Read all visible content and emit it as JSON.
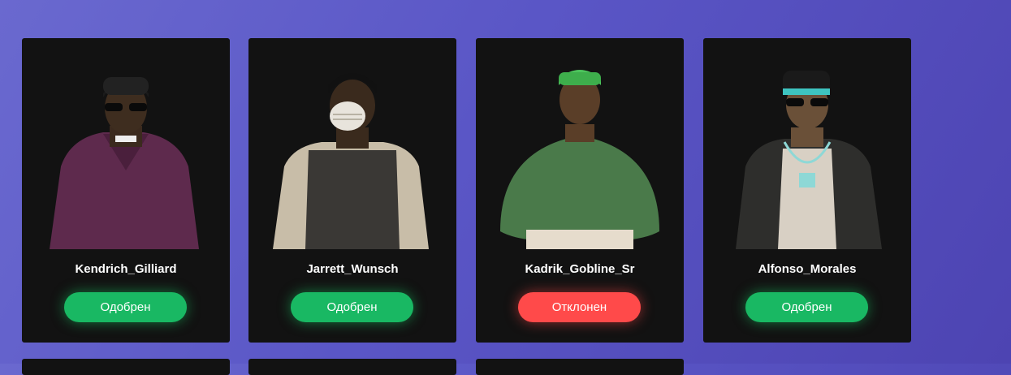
{
  "characters": [
    {
      "name": "Kendrich_Gilliard",
      "status": "Одобрен"
    },
    {
      "name": "Jarrett_Wunsch",
      "status": "Одобрен"
    },
    {
      "name": "Kadrik_Gobline_Sr",
      "status": "Отклонен"
    },
    {
      "name": "Alfonso_Morales",
      "status": "Одобрен"
    }
  ],
  "colors": {
    "approved": "#19b863",
    "rejected": "#ff4a4a",
    "card": "#121212"
  }
}
